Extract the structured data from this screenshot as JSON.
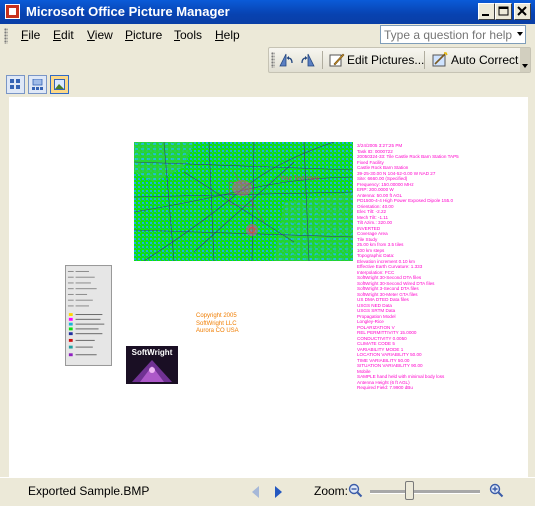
{
  "window": {
    "title": "Microsoft Office Picture Manager"
  },
  "menu": {
    "items": [
      {
        "label": "File",
        "key": "F"
      },
      {
        "label": "Edit",
        "key": "E"
      },
      {
        "label": "View",
        "key": "V"
      },
      {
        "label": "Picture",
        "key": "P"
      },
      {
        "label": "Tools",
        "key": "T"
      },
      {
        "label": "Help",
        "key": "H"
      }
    ]
  },
  "ask": {
    "placeholder": "Type a question for help"
  },
  "toolbar": {
    "edit_pictures_label": "Edit Pictures...",
    "auto_correct_label": "Auto Correct"
  },
  "image": {
    "map_text": "Your Text Here",
    "report_lines": [
      "3/24/2005 3:27:25 PM",
      "Task ID: 0000722",
      "20050324-33: Tile Castle Rock Barn Station TAP5",
      "Fixed Facility",
      "Castle Rock Barn Station",
      "39-25-30.00 N 104-52-0.00 W NAD 27",
      "Site: 6660.00 (Specified)",
      "Frequency: 150.00000 MHz",
      "ERP: 200.0000 W",
      "Antenna: 50.00 ft AGL",
      "PD1500-4-4 High Power Exposed Dipole 155.0",
      "Orientation: 40.00",
      "Elec Tilt: -2.22",
      "Mech Tilt: -1.11",
      "Tilt Azim.: 320.00",
      "INVERTED",
      "Coverage Area",
      "Tile Study",
      "25.00 km from 3.5 tiles",
      "100 km steps",
      "Topographic Data:",
      "Elevation increment 0.10 km",
      "Effective Earth Curvature: 1.333",
      "Interpolation: FCC",
      "SoftWright 30-Second DTA files",
      "SoftWright 30-Second Wired DTA files",
      "SoftWright 3-Second DTA files",
      "SoftWright 30-Meter GTA files",
      "US DMA DTED Data files",
      "USGS NED Data",
      "USGS SRTM Data",
      "Propagation Model",
      "Longley-Rice",
      "POLARIZATION V",
      "REL PERMITTIVITY 15.0000",
      "CONDUCTIVITY 0.0050",
      "CLIMATE CODE 5",
      "VARIABILITY MODE 1",
      "LOCATION VARIABILITY 50.00",
      "TIME VARIABILITY 50.00",
      "SITUATION VARIABILITY 90.00",
      "Mobile",
      "SAMPLE hand held with minimal body loss",
      "Antenna Height (6 ft AGL)",
      "Required Field: 7.9900 dBu"
    ],
    "copyright_lines": [
      "Copyright 2005",
      "SoftWright LLC",
      "Aurora CO USA"
    ],
    "logo_text": "SoftWright"
  },
  "status": {
    "filename": "Exported Sample.BMP",
    "zoom_label": "Zoom:",
    "zoom_level": 0.32
  },
  "colors": {
    "title_bar": "#0a53c8",
    "report_text": "#ff00cc",
    "copyright_text": "#f07d00",
    "map_green": "#10e010",
    "map_cyan": "#18b4d8"
  },
  "icons": {
    "view_buttons": [
      "thumbnail-view-icon",
      "filmstrip-view-icon",
      "single-picture-view-icon"
    ]
  }
}
